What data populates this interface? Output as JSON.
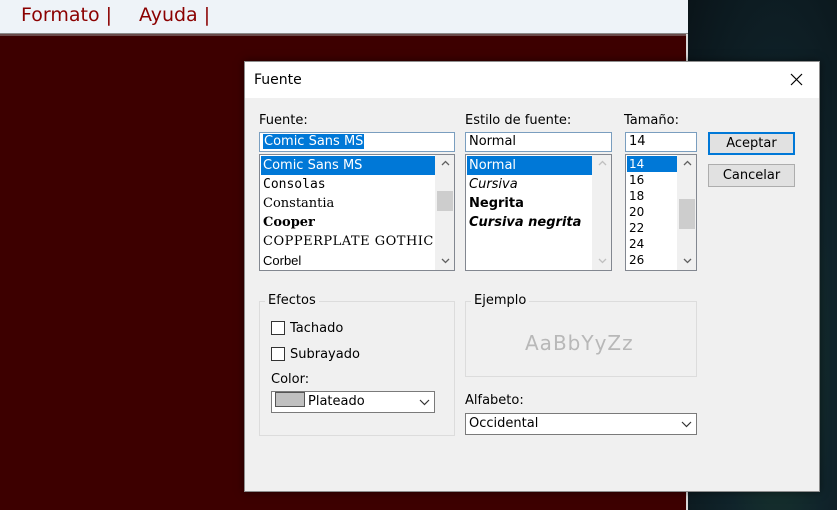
{
  "app": {
    "menu": [
      "Formato |",
      "Ayuda |"
    ]
  },
  "dialog": {
    "title": "Fuente",
    "font": {
      "label": "Fuente:",
      "value": "Comic Sans MS",
      "items": [
        "Comic Sans MS",
        "Consolas",
        "Constantia",
        "Cooper",
        "COPPERPLATE GOTHIC",
        "Corbel"
      ],
      "selected_index": 0
    },
    "style": {
      "label": "Estilo de fuente:",
      "value": "Normal",
      "items": [
        "Normal",
        "Cursiva",
        "Negrita",
        "Cursiva negrita"
      ],
      "selected_index": 0
    },
    "size": {
      "label": "Tamaño:",
      "value": "14",
      "items": [
        "14",
        "16",
        "18",
        "20",
        "22",
        "24",
        "26"
      ],
      "selected_index": 0
    },
    "buttons": {
      "ok": "Aceptar",
      "cancel": "Cancelar"
    },
    "effects": {
      "title": "Efectos",
      "strikeout": {
        "label": "Tachado",
        "checked": false
      },
      "underline": {
        "label": "Subrayado",
        "checked": false
      },
      "color_label": "Color:",
      "color_value": "Plateado",
      "color_hex": "#c0c0c0"
    },
    "sample": {
      "title": "Ejemplo",
      "text": "AaBbYyZz"
    },
    "script": {
      "label": "Alfabeto:",
      "value": "Occidental"
    }
  },
  "colors": {
    "app_background": "#3d0000",
    "menu_text": "#8b0000",
    "selection": "#0078d7"
  }
}
